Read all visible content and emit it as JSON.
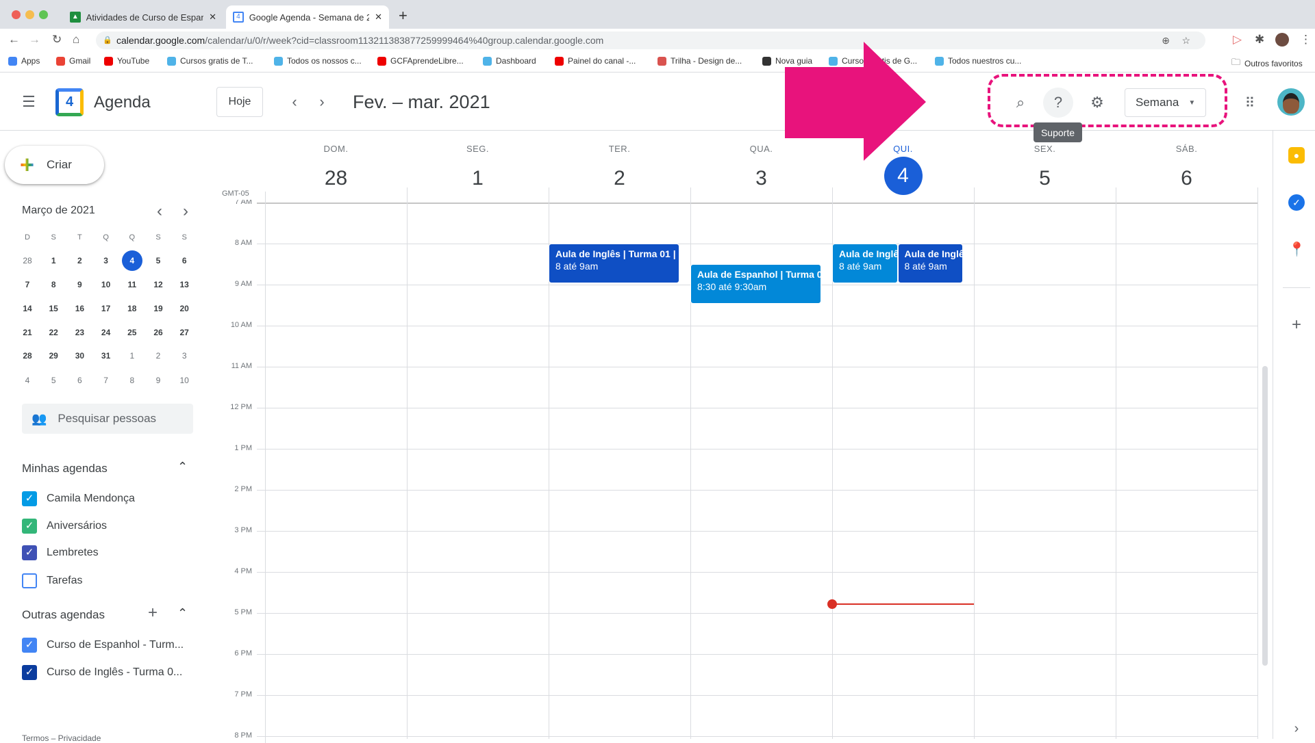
{
  "browser": {
    "tabs": [
      {
        "title": "Atividades de Curso de Espanh",
        "active": false
      },
      {
        "title": "Google Agenda - Semana de 2",
        "active": true
      }
    ],
    "url_host": "calendar.google.com",
    "url_path": "/calendar/u/0/r/week?cid=classroom113211383877259999464%40group.calendar.google.com",
    "bookmarks": [
      "Apps",
      "Gmail",
      "YouTube",
      "Cursos gratis de T...",
      "Todos os nossos c...",
      "GCFAprendeLibre...",
      "Dashboard",
      "Painel do canal -...",
      "Trilha - Design de...",
      "Nova guia",
      "Cursos gratis de G...",
      "Todos nuestros cu..."
    ],
    "other_bookmarks": "Outros favoritos"
  },
  "header": {
    "app_name": "Agenda",
    "logo_number": "4",
    "today_button": "Hoje",
    "date_range": "Fev. – mar. 2021",
    "view_select": "Semana",
    "tooltip": "Suporte"
  },
  "annotation": {
    "color": "#e8137c",
    "highlighted": "search, support, settings, view selector"
  },
  "sidebar": {
    "create": "Criar",
    "mini_calendar": {
      "title": "Março de 2021",
      "weekdays": [
        "D",
        "S",
        "T",
        "Q",
        "Q",
        "S",
        "S"
      ],
      "weeks": [
        [
          "28",
          "1",
          "2",
          "3",
          "4",
          "5",
          "6"
        ],
        [
          "7",
          "8",
          "9",
          "10",
          "11",
          "12",
          "13"
        ],
        [
          "14",
          "15",
          "16",
          "17",
          "18",
          "19",
          "20"
        ],
        [
          "21",
          "22",
          "23",
          "24",
          "25",
          "26",
          "27"
        ],
        [
          "28",
          "29",
          "30",
          "31",
          "1",
          "2",
          "3"
        ],
        [
          "4",
          "5",
          "6",
          "7",
          "8",
          "9",
          "10"
        ]
      ],
      "today": "4"
    },
    "search_people": "Pesquisar pessoas",
    "my_calendars_title": "Minhas agendas",
    "my_calendars": [
      {
        "name": "Camila Mendonça",
        "color": "#039be5",
        "checked": true
      },
      {
        "name": "Aniversários",
        "color": "#33b679",
        "checked": true
      },
      {
        "name": "Lembretes",
        "color": "#3f51b5",
        "checked": true
      },
      {
        "name": "Tarefas",
        "color": "#4285f4",
        "checked": false
      }
    ],
    "other_calendars_title": "Outras agendas",
    "other_calendars": [
      {
        "name": "Curso de Espanhol - Turm...",
        "color": "#4285f4",
        "checked": true
      },
      {
        "name": "Curso de Inglês - Turma 0...",
        "color": "#0b3c9e",
        "checked": true
      }
    ],
    "footer": "Termos – Privacidade"
  },
  "week": {
    "timezone": "GMT-05",
    "days": [
      {
        "label": "DOM.",
        "num": "28"
      },
      {
        "label": "SEG.",
        "num": "1"
      },
      {
        "label": "TER.",
        "num": "2"
      },
      {
        "label": "QUA.",
        "num": "3"
      },
      {
        "label": "QUI.",
        "num": "4",
        "today": true
      },
      {
        "label": "SEX.",
        "num": "5"
      },
      {
        "label": "SÁB.",
        "num": "6"
      }
    ],
    "hours": [
      "7 AM",
      "8 AM",
      "9 AM",
      "10 AM",
      "11 AM",
      "12 PM",
      "1 PM",
      "2 PM",
      "3 PM",
      "4 PM",
      "5 PM",
      "6 PM",
      "7 PM",
      "8 PM"
    ],
    "first_hour": 7,
    "current_time": 16.77,
    "events": [
      {
        "day": 2,
        "title": "Aula de Inglês | Turma 01 |",
        "time": "8 até 9am",
        "start": 8,
        "end": 9,
        "color": "#0f4fc4",
        "col": 0,
        "cols": 1
      },
      {
        "day": 3,
        "title": "Aula de Espanhol | Turma 0",
        "time": "8:30 até 9:30am",
        "start": 8.5,
        "end": 9.5,
        "color": "#0288d8",
        "col": 0,
        "cols": 1
      },
      {
        "day": 4,
        "title": "Aula de Inglês",
        "time": "8 até 9am",
        "start": 8,
        "end": 9,
        "color": "#0288d8",
        "col": 0,
        "cols": 2
      },
      {
        "day": 4,
        "title": "Aula de Inglês",
        "time": "8 até 9am",
        "start": 8,
        "end": 9,
        "color": "#0f4fc4",
        "col": 1,
        "cols": 2
      }
    ]
  }
}
